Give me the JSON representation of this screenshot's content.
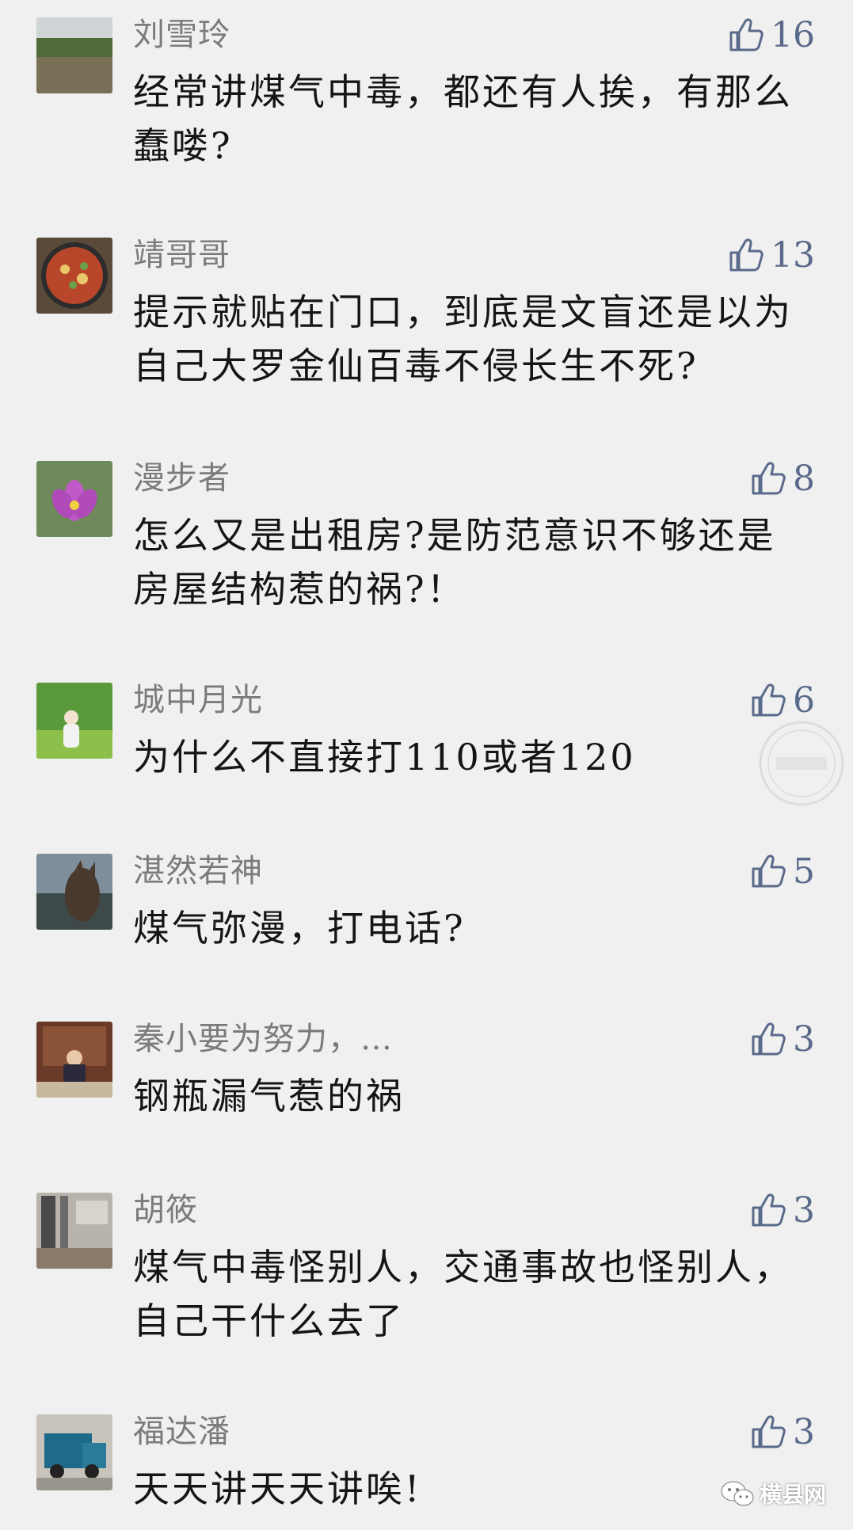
{
  "comments": [
    {
      "name": "刘雪玲",
      "text": "经常讲煤气中毒，都还有人挨，有那么蠢喽?",
      "likes": "16",
      "avatar": "landscape-photo"
    },
    {
      "name": "靖哥哥",
      "text": "提示就贴在门口，到底是文盲还是以为自己大罗金仙百毒不侵长生不死?",
      "likes": "13",
      "avatar": "food-pot-photo"
    },
    {
      "name": "漫步者",
      "text": "怎么又是出租房?是防范意识不够还是房屋结构惹的祸?！",
      "likes": "8",
      "avatar": "lotus-flower-photo"
    },
    {
      "name": "城中月光",
      "text": "为什么不直接打110或者120",
      "likes": "6",
      "avatar": "girl-in-garden-photo"
    },
    {
      "name": "湛然若神",
      "text": "煤气弥漫，打电话?",
      "likes": "5",
      "avatar": "dog-photo"
    },
    {
      "name": "秦小要为努力，…",
      "text": "钢瓶漏气惹的祸",
      "likes": "3",
      "avatar": "person-at-desk-photo"
    },
    {
      "name": "胡筱",
      "text": "煤气中毒怪别人，交通事故也怪别人，自己干什么去了",
      "likes": "3",
      "avatar": "interior-photo"
    },
    {
      "name": "福达潘",
      "text": "天天讲天天讲唉!",
      "likes": "3",
      "avatar": "truck-photo"
    }
  ],
  "brand": {
    "label": "横县网",
    "icon": "wechat-icon"
  },
  "colors": {
    "background": "#f0f0f0",
    "name": "#7b7b7b",
    "like": "#5a6a8a",
    "text": "#151515"
  }
}
